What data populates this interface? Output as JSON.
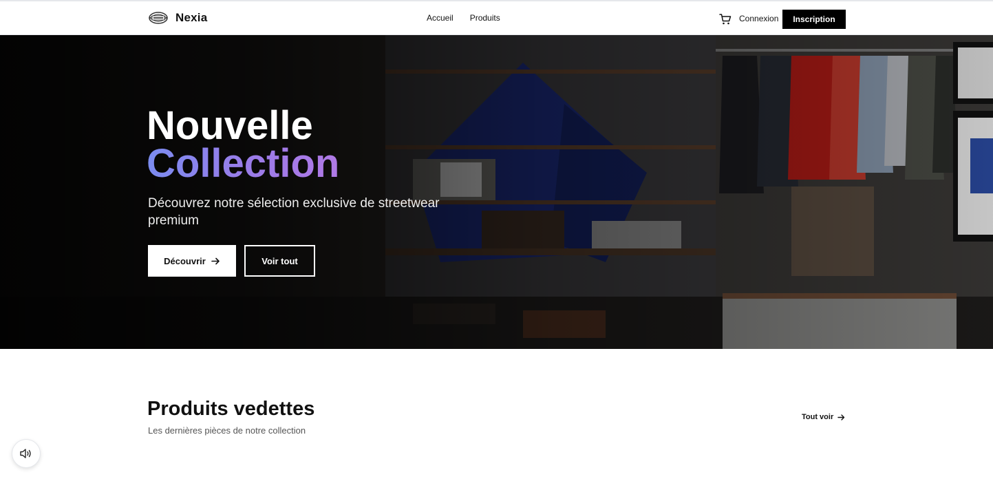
{
  "header": {
    "brand_name": "Nexia",
    "logo_text": "Nexia",
    "nav": [
      {
        "label": "Accueil"
      },
      {
        "label": "Produits"
      }
    ],
    "login_label": "Connexion",
    "signup_label": "Inscription"
  },
  "hero": {
    "title_line1": "Nouvelle",
    "title_line2": "Collection",
    "subtitle": "Découvrez notre sélection exclusive de streetwear premium",
    "primary_button": "Découvrir",
    "secondary_button": "Voir tout",
    "accent_gradient": [
      "#7b8cf0",
      "#b07ae6"
    ]
  },
  "featured": {
    "title": "Produits vedettes",
    "subtitle": "Les dernières pièces de notre collection",
    "see_all_label": "Tout voir"
  },
  "icons": {
    "cart": "cart-icon",
    "arrow": "arrow-right-icon",
    "sound": "speaker-icon"
  }
}
